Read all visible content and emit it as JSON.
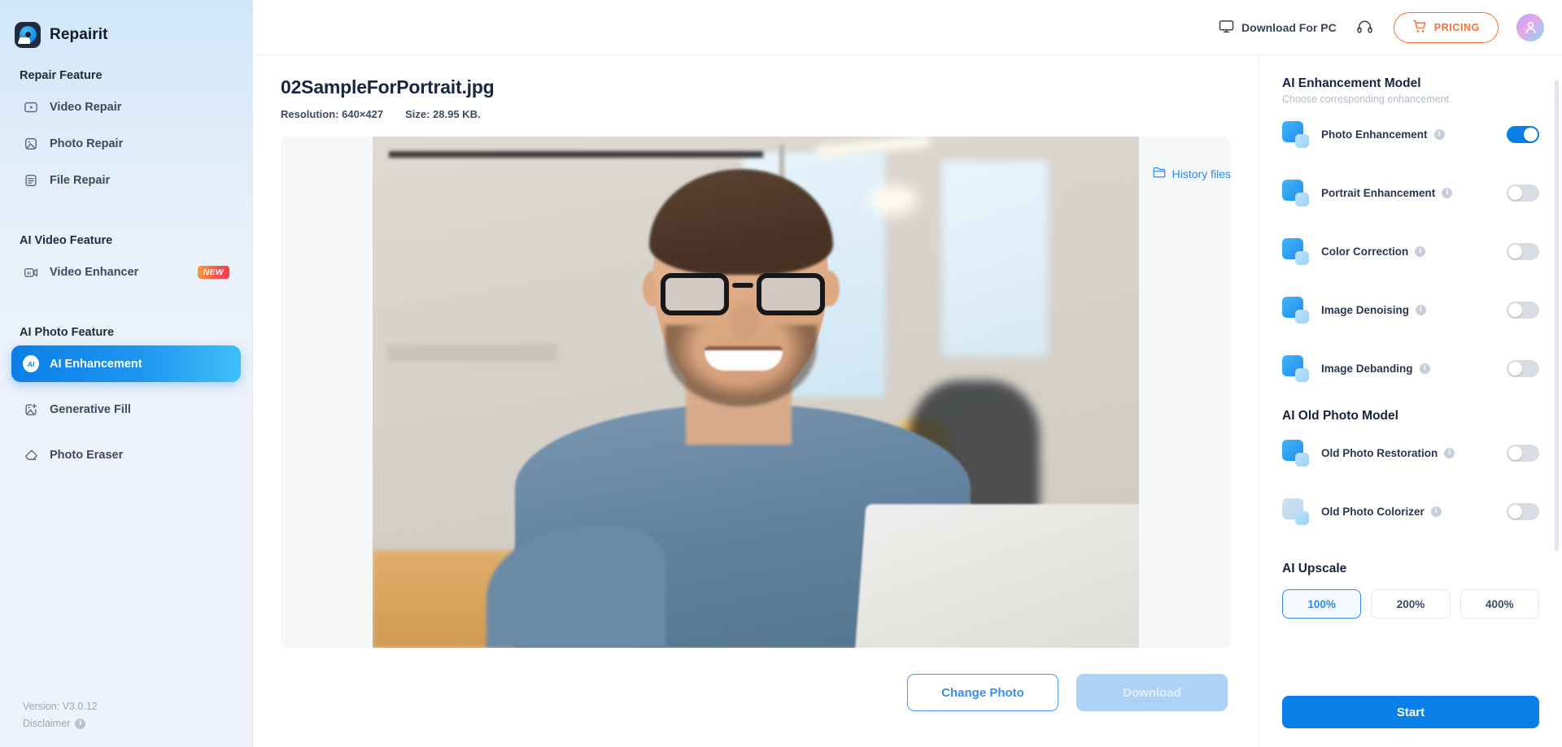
{
  "brand": {
    "name": "Repairit",
    "logo_icon": "repairit-logo-icon"
  },
  "sidebar": {
    "groups": [
      {
        "title": "Repair Feature",
        "items": [
          {
            "label": "Video Repair",
            "icon": "video-repair-icon",
            "active": false,
            "badge": ""
          },
          {
            "label": "Photo Repair",
            "icon": "photo-repair-icon",
            "active": false,
            "badge": ""
          },
          {
            "label": "File Repair",
            "icon": "file-repair-icon",
            "active": false,
            "badge": ""
          }
        ]
      },
      {
        "title": "AI Video Feature",
        "items": [
          {
            "label": "Video Enhancer",
            "icon": "video-enhancer-icon",
            "active": false,
            "badge": "NEW"
          }
        ]
      },
      {
        "title": "AI Photo Feature",
        "items": [
          {
            "label": "AI Enhancement",
            "icon": "ai-enhancement-icon",
            "active": true,
            "badge": ""
          },
          {
            "label": "Generative Fill",
            "icon": "generative-fill-icon",
            "active": false,
            "badge": ""
          },
          {
            "label": "Photo Eraser",
            "icon": "photo-eraser-icon",
            "active": false,
            "badge": ""
          }
        ]
      }
    ],
    "footer": {
      "version": "Version: V3.0.12",
      "disclaimer": "Disclaimer",
      "info_icon": "info-icon"
    }
  },
  "topbar": {
    "download_for_pc": "Download For PC",
    "download_icon": "monitor-icon",
    "support_icon": "headphone-support-icon",
    "pricing": "PRICING",
    "pricing_icon": "shopping-cart-icon",
    "avatar_icon": "user-avatar-icon"
  },
  "main": {
    "file_name": "02SampleForPortrait.jpg",
    "resolution": "Resolution: 640×427",
    "size": "Size: 28.95 KB.",
    "history_files": "History files",
    "history_icon": "folder-icon",
    "preview_alt": "Smiling man with glasses at office desk with laptop",
    "change_photo": "Change Photo",
    "download": "Download"
  },
  "panel": {
    "title": "AI Enhancement Model",
    "subtitle": "Choose corresponding enhancement",
    "enhancement_options": [
      {
        "label": "Photo Enhancement",
        "icon": "photo-enhancement-icon",
        "on": true
      },
      {
        "label": "Portrait Enhancement",
        "icon": "portrait-enhancement-icon",
        "on": false
      },
      {
        "label": "Color Correction",
        "icon": "color-correction-icon",
        "on": false
      },
      {
        "label": "Image Denoising",
        "icon": "image-denoising-icon",
        "on": false
      },
      {
        "label": "Image Debanding",
        "icon": "image-debanding-icon",
        "on": false
      }
    ],
    "old_photo_title": "AI Old Photo Model",
    "old_photo_options": [
      {
        "label": "Old Photo Restoration",
        "icon": "old-photo-restoration-icon",
        "on": false
      },
      {
        "label": "Old Photo Colorizer",
        "icon": "old-photo-colorizer-icon",
        "on": false
      }
    ],
    "upscale_title": "AI Upscale",
    "upscale_options": [
      {
        "label": "100%",
        "selected": true
      },
      {
        "label": "200%",
        "selected": false
      },
      {
        "label": "400%",
        "selected": false
      }
    ],
    "start": "Start"
  },
  "colors": {
    "accent": "#0a7fe8",
    "pricing": "#f0713a",
    "sidebar_active_from": "#0a7fe8",
    "sidebar_active_to": "#3ec0f7",
    "badge_new": "#fb5445",
    "link": "#2f89e5"
  }
}
